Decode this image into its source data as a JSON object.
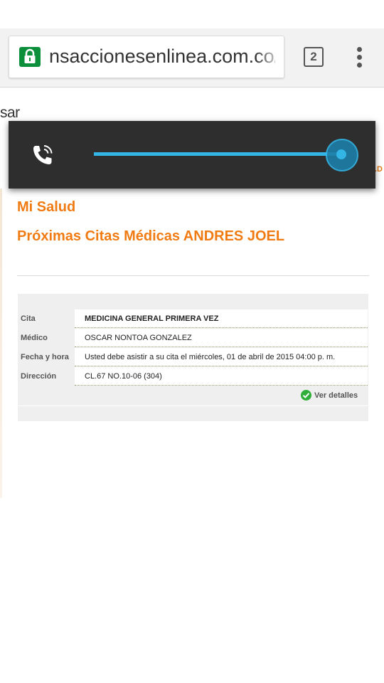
{
  "browser": {
    "url": "nsaccionesenlinea.com.co/e",
    "tab_count": "2",
    "icons": {
      "lock": "lock-icon",
      "menu": "overflow-menu-icon"
    }
  },
  "page": {
    "logo_fragment": "sar",
    "edge_label": ".D",
    "section_title": "Mi Salud",
    "appointments_title": "Próximas Citas Médicas ANDRES JOEL"
  },
  "appointment": {
    "rows": [
      {
        "label": "Cita",
        "value": "MEDICINA GENERAL PRIMERA VEZ"
      },
      {
        "label": "Médico",
        "value": "OSCAR NONTOA GONZALEZ"
      },
      {
        "label": "Fecha y hora",
        "value": "Usted debe asistir a su cita el miércoles, 01 de abril de 2015 04:00 p. m."
      },
      {
        "label": "Dirección",
        "value": "CL.67 NO.10-06 (304)"
      }
    ],
    "details_link": "Ver detalles"
  },
  "volume_overlay": {
    "stream_icon": "phone-call-icon",
    "level_fraction": 1.0,
    "accent_color": "#33b5e5"
  },
  "colors": {
    "heading": "#f07b12",
    "secure_lock": "#0b8f3a",
    "check": "#2fae3a"
  }
}
